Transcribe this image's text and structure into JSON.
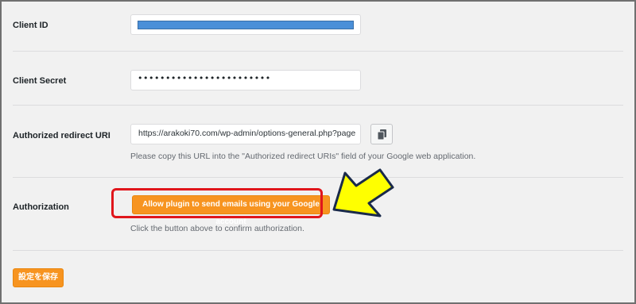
{
  "fields": {
    "client_id": {
      "label": "Client ID",
      "value": ""
    },
    "client_secret": {
      "label": "Client Secret",
      "value": "••••••••••••••••••••••••"
    },
    "redirect_uri": {
      "label": "Authorized redirect URI",
      "value": "https://arakoki70.com/wp-admin/options-general.php?page",
      "description": "Please copy this URL into the \"Authorized redirect URIs\" field of your Google web application."
    },
    "authorization": {
      "label": "Authorization",
      "button_label": "Allow plugin to send emails using your Google account",
      "description": "Click the button above to confirm authorization."
    }
  },
  "footer": {
    "save_label": "設定を保存"
  },
  "colors": {
    "accent_orange": "#f79420",
    "highlight_red": "#e0161c",
    "arrow_yellow": "#ffff00",
    "redaction_blue": "#4a8fd8"
  },
  "icons": {
    "copy": "copy-icon",
    "pointer": "arrow-pointer-icon"
  }
}
